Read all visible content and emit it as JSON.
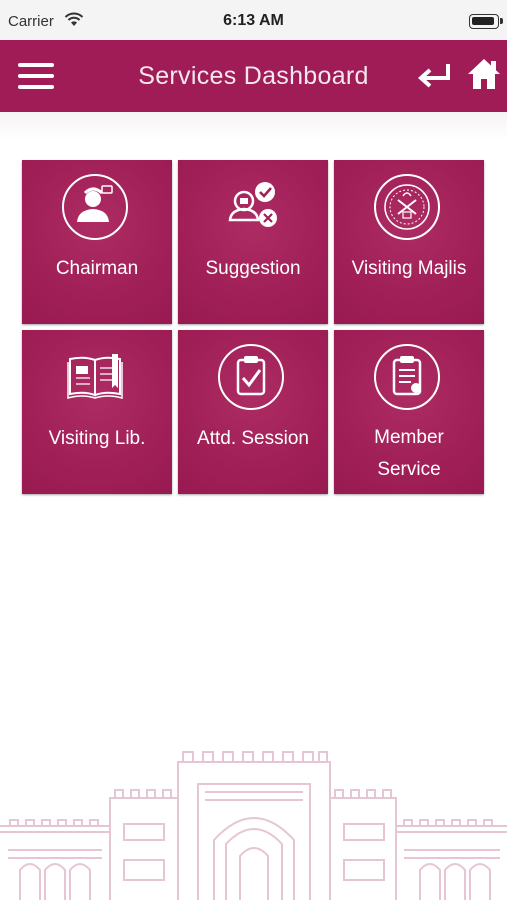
{
  "status_bar": {
    "carrier": "Carrier",
    "time": "6:13 AM"
  },
  "nav": {
    "title": "Services Dashboard",
    "menu_icon": "hamburger-icon",
    "back_icon": "return-arrow-icon",
    "home_icon": "home-icon"
  },
  "colors": {
    "brand": "#a01c56",
    "tile": "#a11f57",
    "art": "#e8c7d6"
  },
  "tiles": [
    {
      "label": "Chairman",
      "icon": "chairman-icon"
    },
    {
      "label": "Suggestion",
      "icon": "suggestion-icon"
    },
    {
      "label": "Visiting Majlis",
      "icon": "emblem-icon"
    },
    {
      "label": "Visiting Lib.",
      "icon": "book-icon"
    },
    {
      "label": "Attd. Session",
      "icon": "clipboard-check-icon"
    },
    {
      "label_line1": "Member",
      "label_line2": "Service",
      "icon": "clipboard-list-icon"
    }
  ]
}
